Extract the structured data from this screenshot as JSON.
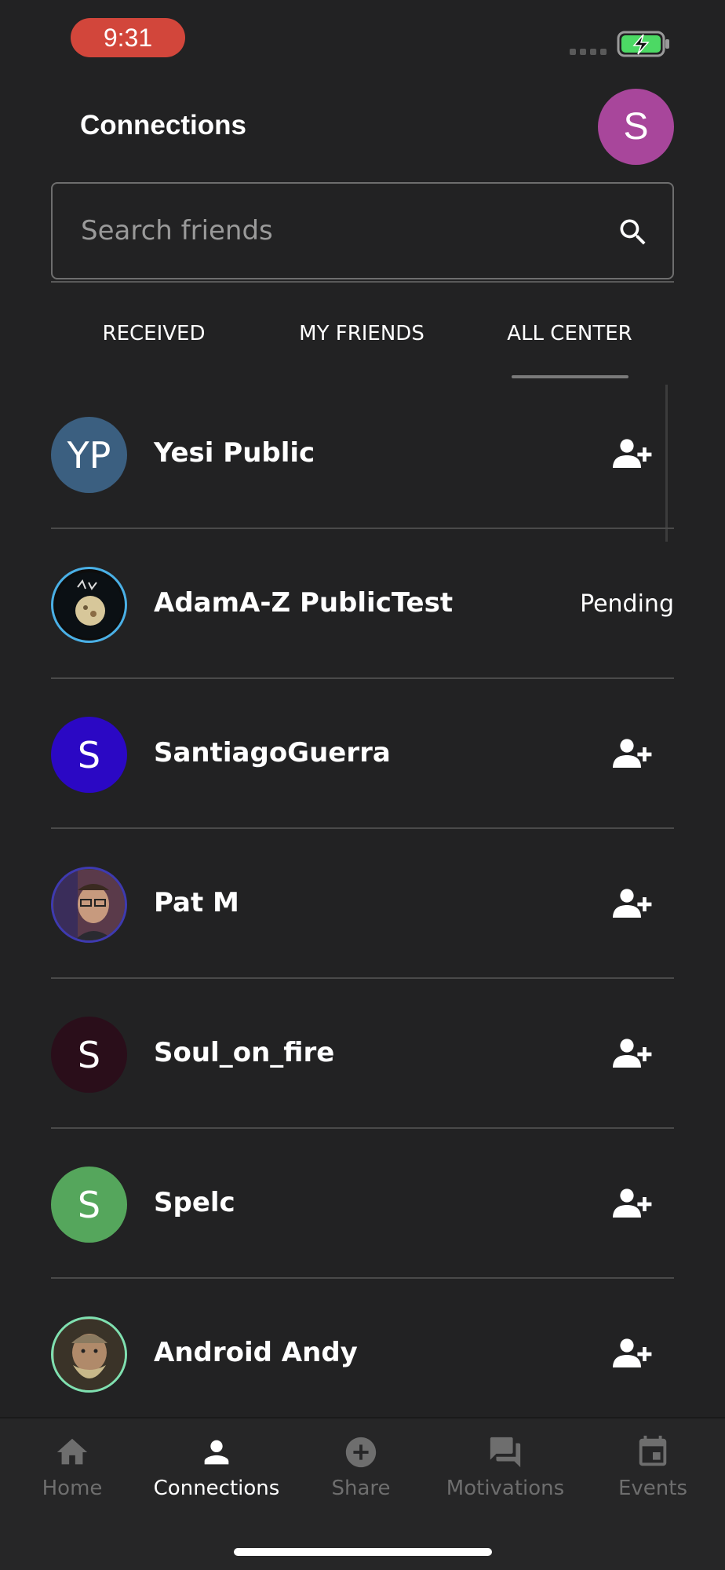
{
  "status_bar": {
    "time": "9:31"
  },
  "header": {
    "title": "Connections",
    "avatar_initial": "S",
    "avatar_color": "#a8469b"
  },
  "search": {
    "placeholder": "Search friends",
    "value": ""
  },
  "tabs": [
    {
      "label": "RECEIVED",
      "active": false
    },
    {
      "label": "MY FRIENDS",
      "active": false
    },
    {
      "label": "ALL CENTER",
      "active": true
    }
  ],
  "connections": [
    {
      "name": "Yesi Public",
      "initials": "YP",
      "avatar_color": "#3b5f80",
      "action": "add-person-icon"
    },
    {
      "name": "AdamA-Z PublicTest",
      "initials": "",
      "avatar_color": "#1b2830",
      "status": "Pending"
    },
    {
      "name": "SantiagoGuerra",
      "initials": "S",
      "avatar_color": "#2b08c4",
      "action": "add-person-icon"
    },
    {
      "name": "Pat M",
      "initials": "",
      "avatar_color": "#5a4a3e",
      "action": "add-person-icon"
    },
    {
      "name": "Soul_on_fire",
      "initials": "S",
      "avatar_color": "#2a0e1a",
      "action": "add-person-icon"
    },
    {
      "name": "Spelc",
      "initials": "S",
      "avatar_color": "#55a65c",
      "action": "add-person-icon"
    },
    {
      "name": "Android Andy",
      "initials": "",
      "avatar_color": "#7a6a55",
      "action": "add-person-icon"
    }
  ],
  "bottom_nav": [
    {
      "label": "Home",
      "icon": "home-icon",
      "active": false
    },
    {
      "label": "Connections",
      "icon": "person-icon",
      "active": true
    },
    {
      "label": "Share",
      "icon": "plus-circle-icon",
      "active": false
    },
    {
      "label": "Motivations",
      "icon": "chat-icon",
      "active": false
    },
    {
      "label": "Events",
      "icon": "calendar-icon",
      "active": false
    }
  ]
}
